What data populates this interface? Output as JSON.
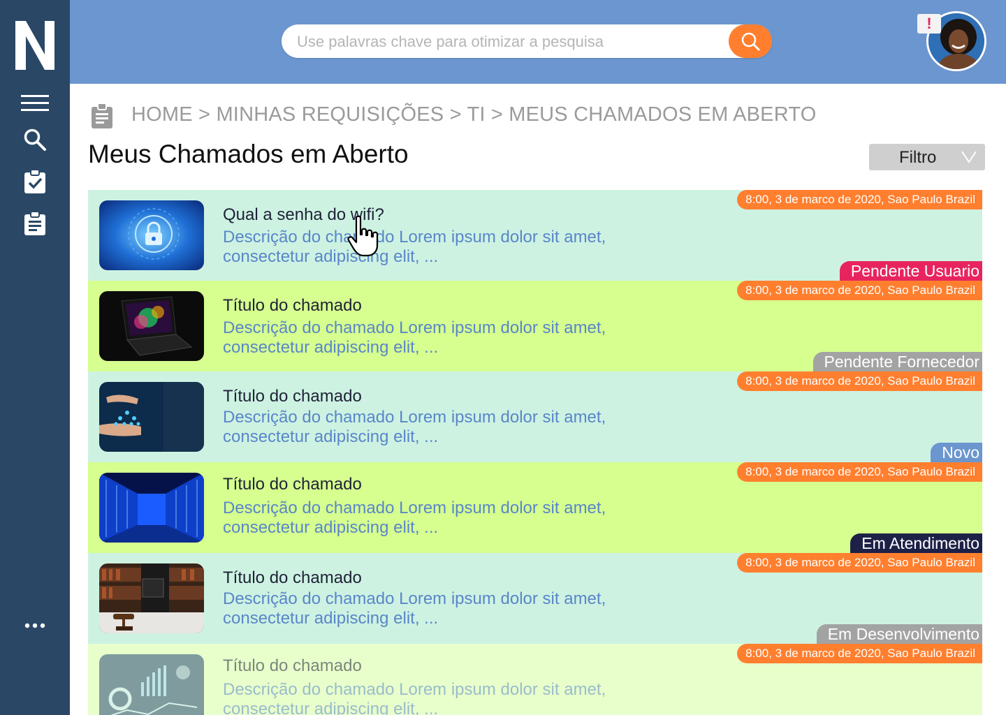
{
  "app": {
    "logo_letter": "N"
  },
  "sidebar": {
    "items": [
      {
        "name": "menu-icon"
      },
      {
        "name": "search-icon"
      },
      {
        "name": "checklist-icon"
      },
      {
        "name": "clipboard-icon"
      },
      {
        "name": "more-icon"
      }
    ]
  },
  "header": {
    "search_placeholder": "Use palavras chave para otimizar a pesquisa",
    "alert_badge": "!"
  },
  "breadcrumb": "HOME > MINHAS REQUISIÇÕES > TI > MEUS CHAMADOS EM ABERTO",
  "page_title": "Meus Chamados em Aberto",
  "filter_label": "Filtro",
  "colors": {
    "sidebar": "#2a4766",
    "header": "#6b96cf",
    "accent_orange": "#ff7f2f",
    "row_mint": "#cdf2e2",
    "row_lime": "#d6ff8f",
    "row_pale_lime": "#e8ffcc",
    "status_pendente_usuario": "#e8245e",
    "status_pendente_fornecedor": "#a3a3a3",
    "status_novo": "#6b96cf",
    "status_em_atendimento": "#1d2147",
    "status_em_desenvolvimento": "#a3a3a3"
  },
  "tickets": [
    {
      "title": "Qual a senha do wifi?",
      "desc": "Descrição do chamado Lorem ipsum dolor sit amet, consectetur adipiscing elit, ...",
      "timestamp": "8:00, 3 de marco de 2020, Sao Paulo Brazil",
      "status": "Pendente Usuario",
      "bg": "#cdf2e2",
      "status_color": "#e8245e",
      "thumb": "network-security-image"
    },
    {
      "title": "Título do chamado",
      "desc": "Descrição do chamado Lorem ipsum dolor sit amet, consectetur adipiscing elit, ...",
      "timestamp": "8:00, 3 de marco de 2020, Sao Paulo Brazil",
      "status": "Pendente Fornecedor",
      "bg": "#d6ff8f",
      "status_color": "#a3a3a3",
      "thumb": "laptop-image"
    },
    {
      "title": "Título do chamado",
      "desc": "Descrição do chamado Lorem ipsum dolor sit amet, consectetur adipiscing elit, ...",
      "timestamp": "8:00, 3 de marco de 2020, Sao Paulo Brazil",
      "status": "Novo",
      "bg": "#cdf2e2",
      "status_color": "#6b96cf",
      "thumb": "hands-network-image"
    },
    {
      "title": "Título do chamado",
      "desc": "Descrição do chamado Lorem ipsum dolor sit amet, consectetur adipiscing elit, ...",
      "timestamp": "8:00, 3 de marco de 2020, Sao Paulo Brazil",
      "status": "Em Atendimento",
      "bg": "#d6ff8f",
      "status_color": "#1d2147",
      "thumb": "server-room-image"
    },
    {
      "title": "Título do chamado",
      "desc": "Descrição do chamado Lorem ipsum dolor sit amet, consectetur adipiscing elit, ...",
      "timestamp": "8:00, 3 de marco de 2020, Sao Paulo Brazil",
      "status": "Em Desenvolvimento",
      "bg": "#cdf2e2",
      "status_color": "#a3a3a3",
      "thumb": "law-office-image"
    },
    {
      "title": "Título do chamado",
      "desc": "Descrição do chamado Lorem ipsum dolor sit amet, consectetur adipiscing elit, ...",
      "timestamp": "8:00, 3 de marco de 2020, Sao Paulo Brazil",
      "status": "",
      "bg": "#e8ffcc",
      "status_color": "",
      "thumb": "analytics-image"
    }
  ]
}
